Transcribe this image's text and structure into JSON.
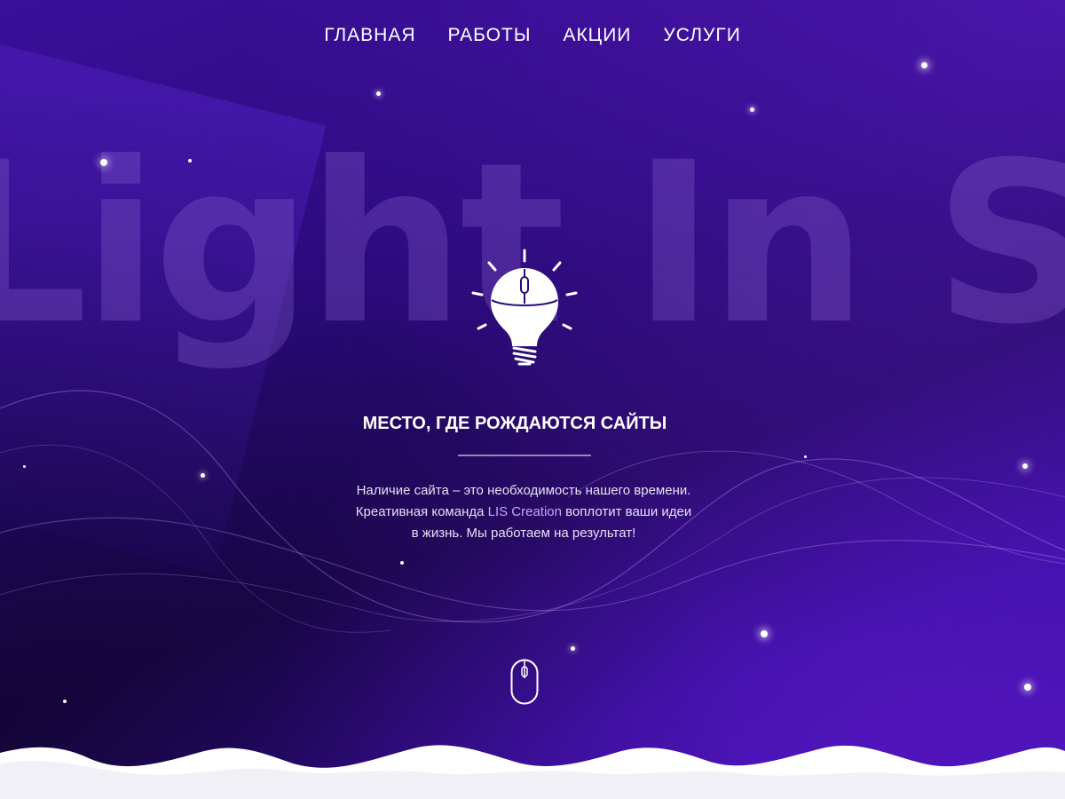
{
  "nav": {
    "items": [
      {
        "label": "ГЛАВНАЯ"
      },
      {
        "label": "РАБОТЫ"
      },
      {
        "label": "АКЦИИ"
      },
      {
        "label": "УСЛУГИ"
      }
    ]
  },
  "hero": {
    "bg_title": "Light In Sky",
    "headline": "МЕСТО, ГДЕ РОЖДАЮТСЯ САЙТЫ",
    "description": {
      "line1": "Наличие сайта – это необходимость нашего времени.",
      "line2_before": "Креативная команда ",
      "brand": "LIS Creation",
      "line2_after": " воплотит ваши идеи",
      "line3": "в жизнь. Мы работаем на результат!"
    }
  },
  "icons": {
    "bulb": "lightbulb-icon",
    "scroll": "mouse-scroll-icon"
  },
  "colors": {
    "accent": "#c7a7ff",
    "bg_primary": "#2a0a7a",
    "text": "#ffffff"
  }
}
